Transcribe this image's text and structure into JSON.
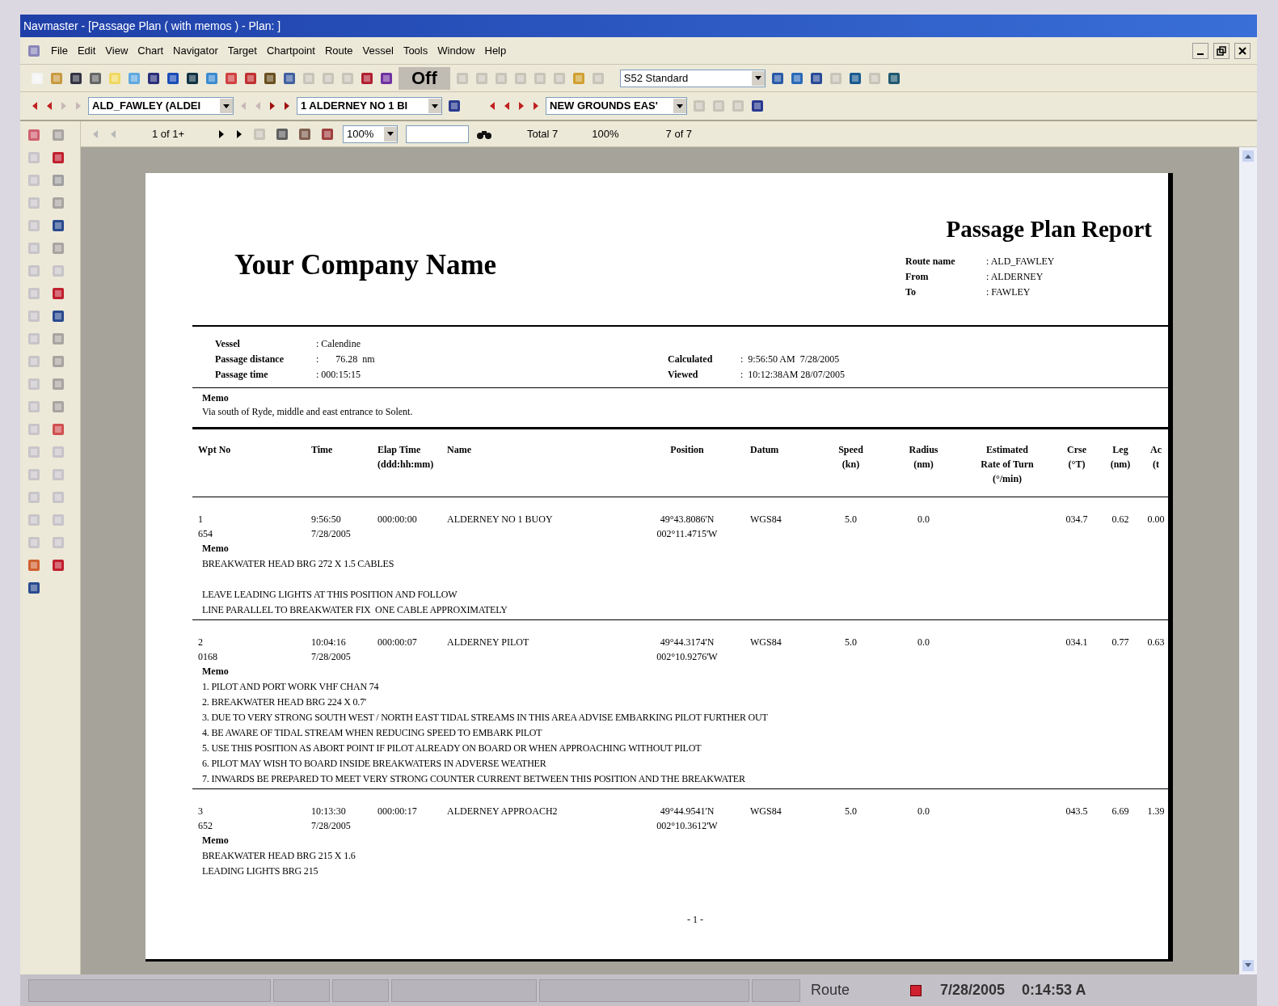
{
  "window": {
    "title": "Navmaster - [Passage Plan ( with memos ) - Plan: ]"
  },
  "menu": [
    "File",
    "Edit",
    "View",
    "Chart",
    "Navigator",
    "Target",
    "Chartpoint",
    "Route",
    "Vessel",
    "Tools",
    "Window",
    "Help"
  ],
  "toolbar": {
    "mode_label": "Off",
    "style_select": "S52 Standard"
  },
  "route_bar": {
    "route_select": "ALD_FAWLEY (ALDEI",
    "waypoint_select": "1 ALDERNEY NO 1 BI",
    "leg_select": "NEW GROUNDS EAS'"
  },
  "report_bar": {
    "page": "1 of 1+",
    "zoom_select": "100%",
    "total": "Total 7",
    "percent": "100%",
    "count": "7 of 7"
  },
  "report": {
    "company": "Your Company Name",
    "title": "Passage Plan Report",
    "route_fields": [
      {
        "label": "Route name",
        "value": ": ALD_FAWLEY"
      },
      {
        "label": "From",
        "value": ": ALDERNEY"
      },
      {
        "label": "To",
        "value": ": FAWLEY"
      }
    ],
    "vessel_fields": [
      {
        "label": "Vessel",
        "value": ": Calendine"
      },
      {
        "label": "Passage distance",
        "value": ":       76.28  nm"
      },
      {
        "label": "Passage time",
        "value": ": 000:15:15"
      }
    ],
    "time_fields": [
      {
        "label": "Calculated",
        "value": ":  9:56:50 AM  7/28/2005"
      },
      {
        "label": "Viewed",
        "value": ":  10:12:38AM 28/07/2005"
      }
    ],
    "memo_label": "Memo",
    "memo": "Via south of Ryde, middle and east entrance to Solent.",
    "columns": [
      "Wpt No",
      "Time",
      "Elap Time\n(ddd:hh:mm)",
      "Name",
      "Position",
      "Datum",
      "Speed\n(kn)",
      "Radius\n(nm)",
      "Estimated\nRate of Turn\n(°/min)",
      "Crse\n(°T)",
      "Leg\n(nm)",
      "Ac\n(t"
    ],
    "rows": [
      {
        "cells": [
          "1\n654",
          "9:56:50\n7/28/2005",
          "000:00:00",
          "ALDERNEY NO 1 BUOY",
          "49°43.8086'N\n002°11.4715'W",
          "WGS84",
          "5.0",
          "0.0",
          null,
          "034.7",
          "0.62",
          "0.00"
        ],
        "memo_label": "Memo",
        "memo": [
          [
            "BREAKWATER HEAD BRG 272 X 1.5 CABLES"
          ],
          [
            "LEAVE LEADING LIGHTS AT THIS POSITION AND FOLLOW",
            "LINE PARALLEL TO BREAKWATER FIX  ONE CABLE APPROXIMATELY"
          ]
        ]
      },
      {
        "cells": [
          "2\n0168",
          "10:04:16\n7/28/2005",
          "000:00:07",
          "ALDERNEY PILOT",
          "49°44.3174'N\n002°10.9276'W",
          "WGS84",
          "5.0",
          "0.0",
          null,
          "034.1",
          "0.77",
          "0.63"
        ],
        "memo_label": "Memo",
        "memo": [
          [
            "1. PILOT AND PORT WORK VHF CHAN 74",
            "2. BREAKWATER HEAD BRG 224 X 0.7'",
            "3. DUE TO VERY STRONG SOUTH WEST / NORTH EAST TIDAL STREAMS IN THIS AREA ADVISE EMBARKING PILOT FURTHER OUT",
            "4. BE AWARE OF TIDAL STREAM WHEN REDUCING SPEED TO EMBARK PILOT",
            "5. USE THIS POSITION AS ABORT POINT IF PILOT ALREADY ON BOARD OR WHEN APPROACHING WITHOUT PILOT",
            "6. PILOT MAY WISH TO BOARD INSIDE BREAKWATERS IN ADVERSE WEATHER",
            "7. INWARDS BE PREPARED TO MEET VERY STRONG COUNTER CURRENT BETWEEN THIS POSITION AND THE BREAKWATER"
          ]
        ]
      },
      {
        "cells": [
          "3\n652",
          "10:13:30\n7/28/2005",
          "000:00:17",
          "ALDERNEY APPROACH2",
          "49°44.9541'N\n002°10.3612'W",
          "WGS84",
          "5.0",
          "0.0",
          null,
          "043.5",
          "6.69",
          "1.39"
        ],
        "memo_label": "Memo",
        "memo": [
          [
            "BREAKWATER HEAD BRG 215 X 1.6",
            "LEADING LIGHTS BRG 215"
          ]
        ]
      }
    ],
    "page_number": "- 1 -"
  },
  "status_bar": {
    "mode": "Route",
    "date": "7/28/2005",
    "time": "0:14:53 A"
  }
}
